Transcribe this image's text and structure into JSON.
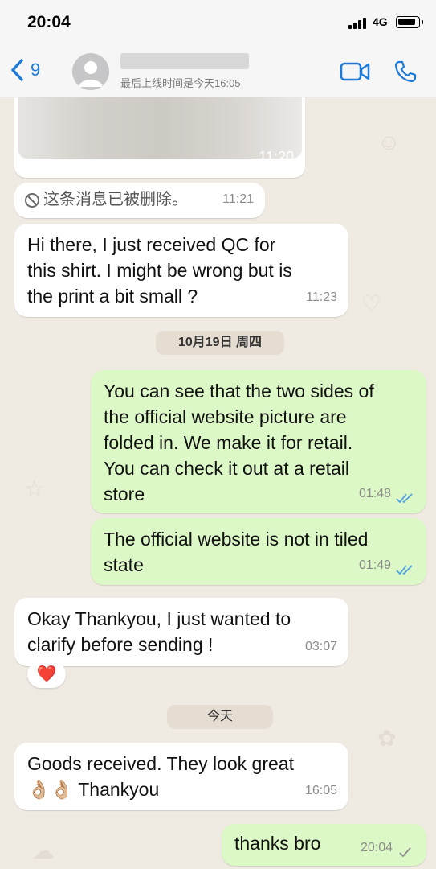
{
  "status_bar": {
    "time": "20:04",
    "network": "4G"
  },
  "header": {
    "back_count": "9",
    "last_seen": "最后上线时间是今天16:05"
  },
  "messages": {
    "image_msg": {
      "time": "11:20"
    },
    "deleted_msg": {
      "text": "这条消息已被删除。",
      "time": "11:21"
    },
    "msg_qc": {
      "text": "Hi there, I just received QC for\nthis shirt. I might be wrong but is\nthe print a bit small ?",
      "time": "11:23"
    },
    "date_1": "10月19日 周四",
    "msg_folded": {
      "text": "You can see that the two sides of\nthe official website picture are\nfolded in. We make it for retail.\nYou can check it out at a retail\nstore",
      "time": "01:48"
    },
    "msg_tiled": {
      "text": "The official website is not in tiled\nstate",
      "time": "01:49"
    },
    "msg_okay": {
      "text": "Okay Thankyou, I just wanted to\nclarify before sending !",
      "time": "03:07",
      "reaction": "❤️"
    },
    "date_2": "今天",
    "msg_goods": {
      "text_line1": "Goods received. They look great",
      "emoji": "👌🏼👌🏼",
      "text_line2": " Thankyou",
      "time": "16:05"
    },
    "msg_thanks": {
      "text": "thanks bro",
      "time": "20:04"
    }
  },
  "colors": {
    "accent": "#1d7ad9",
    "outgoing": "#dcf8c6",
    "incoming": "#ffffff",
    "read_tick": "#4fa3e0"
  }
}
